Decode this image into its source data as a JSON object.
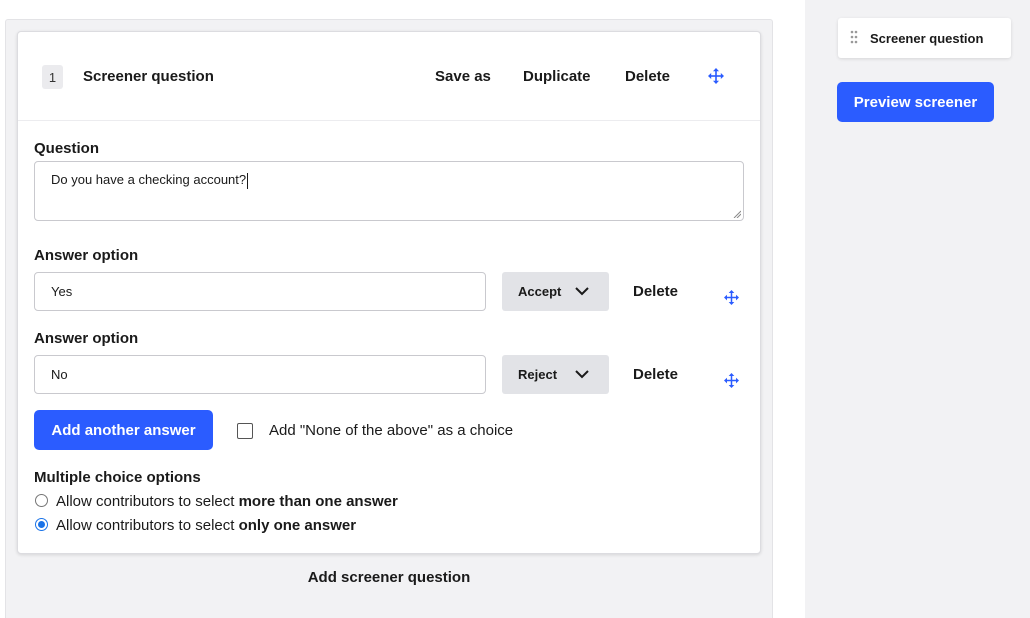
{
  "question": {
    "number": "1",
    "title": "Screener question",
    "actions": {
      "save_as": "Save as",
      "duplicate": "Duplicate",
      "delete": "Delete"
    },
    "question_label": "Question",
    "question_text": "Do you have a checking account?",
    "answers": [
      {
        "label": "Answer option",
        "value": "Yes",
        "status": "Accept",
        "delete": "Delete"
      },
      {
        "label": "Answer option",
        "value": "No",
        "status": "Reject",
        "delete": "Delete"
      }
    ],
    "add_answer_label": "Add another answer",
    "none_of_above": {
      "label": "Add \"None of the above\" as a choice",
      "checked": false
    },
    "multiple_choice": {
      "heading": "Multiple choice options",
      "options": [
        {
          "prefix": "Allow contributors to select ",
          "emphasis": "more than one answer",
          "checked": false
        },
        {
          "prefix": "Allow contributors to select ",
          "emphasis": "only one answer",
          "checked": true
        }
      ]
    }
  },
  "add_screener_question": "Add screener question",
  "sidebar": {
    "outline_item": "Screener question",
    "preview_button": "Preview screener"
  },
  "colors": {
    "primary": "#2b5cff",
    "move_icon": "#2b5cff",
    "panel_bg": "#f2f2f4"
  },
  "icons": {
    "move": "move-arrows-icon",
    "chevron": "chevron-down-icon",
    "grip": "drag-handle-icon"
  }
}
